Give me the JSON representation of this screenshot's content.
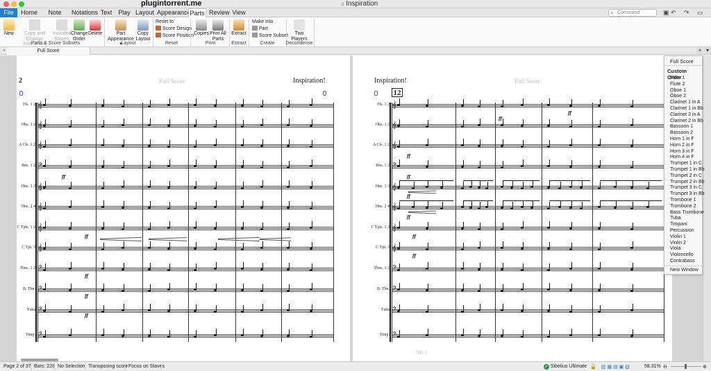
{
  "window": {
    "title": "Inspiration",
    "watermark": "plugintorrent.me"
  },
  "tabs": [
    "File",
    "Home",
    "Note Input",
    "Notations",
    "Text",
    "Play",
    "Layout",
    "Appearance",
    "Parts",
    "Review",
    "View"
  ],
  "active_tab": "Parts",
  "command_search": {
    "placeholder": "Command Search"
  },
  "ribbon": {
    "new": "New",
    "copy_change": "Copy and Change Instrument",
    "included": "Included Staves",
    "change_order": "Change Order",
    "delete": "Delete",
    "group_parts": "Parts & Score Subsets",
    "part_appearance": "Part Appearance",
    "copy_layout": "Copy Layout",
    "group_layout": "Layout",
    "reset_to": "Reset to",
    "score_design": "Score Design",
    "score_position": "Score Position",
    "group_reset": "Reset",
    "copies": "Copies",
    "print_all": "Print All Parts",
    "group_print": "Print",
    "extract": "Extract",
    "group_extract": "Extract",
    "make_into": "Make into",
    "part": "Part",
    "score_subset": "Score Subset",
    "group_create": "Create",
    "two_players": "Two Players",
    "group_decondense": "Decondense"
  },
  "doc_tab": "Full Score",
  "left_page": {
    "page_number": "2",
    "header": "Full Score",
    "title": "Inspiration!",
    "instruments": [
      "Fls. 1 2",
      "Obs. 1 2",
      "A Cls. 1 2",
      "Bns. 1 2",
      "Hns. 1 3",
      "Hns. 2 4",
      "C Tpts. 1 2",
      "C Tpt. 3",
      "Tbns. 1 2",
      "B. Tbn.",
      "Tuba",
      "Timp."
    ]
  },
  "right_page": {
    "title": "Inspiration!",
    "header": "Full Score",
    "bar_number": "12",
    "instruments": [
      "Fls. 1 2",
      "Obs. 1 2",
      "A Cls. 1 2",
      "Bns. 1 2",
      "Hns. 1 3",
      "Hns. 2 4",
      "C Tpts. 1 2",
      "C Tpt. 3",
      "Tbns. 1 2",
      "B. Tbn.",
      "Tuba",
      "Timp."
    ],
    "bottom_hint": "Tpts 1"
  },
  "parts_menu": {
    "full_score": "Full Score",
    "custom_order": "Custom Order",
    "items": [
      "Flute 1",
      "Flute 2",
      "Oboe 1",
      "Oboe 2",
      "Clarinet 1 in A",
      "Clarinet 1 in Bb",
      "Clarinet 2 in A",
      "Clarinet 2 in Bb",
      "Bassoon 1",
      "Bassoon 2",
      "Horn 1 in F",
      "Horn 2 in F",
      "Horn 3 in F",
      "Horn 4 in F",
      "Trumpet 1 in C",
      "Trumpet 1 in Bb",
      "Trumpet 2 in C",
      "Trumpet 2 in Bb",
      "Trumpet 3 in C",
      "Trumpet 3 in Bb",
      "Trombone 1",
      "Trombone 2",
      "Bass Trombone",
      "Tuba",
      "Timpani",
      "Percussion",
      "Violin 1",
      "Violin 2",
      "Viola",
      "Violoncello",
      "Contrabass"
    ],
    "new_window": "New Window"
  },
  "status": {
    "page": "Page 2 of 37",
    "bars": "Bars: 228",
    "selection": "No Selection",
    "transposing": "Transposing score",
    "focus": "Focus on Staves",
    "edition": "Sibelius Ultimate",
    "zoom": "58.31%"
  },
  "dynamic_marking": "ff",
  "colors": {
    "accent": "#1f7fd4",
    "selection_blue": "#3a67ff",
    "edition_green": "#2a9a3a"
  }
}
